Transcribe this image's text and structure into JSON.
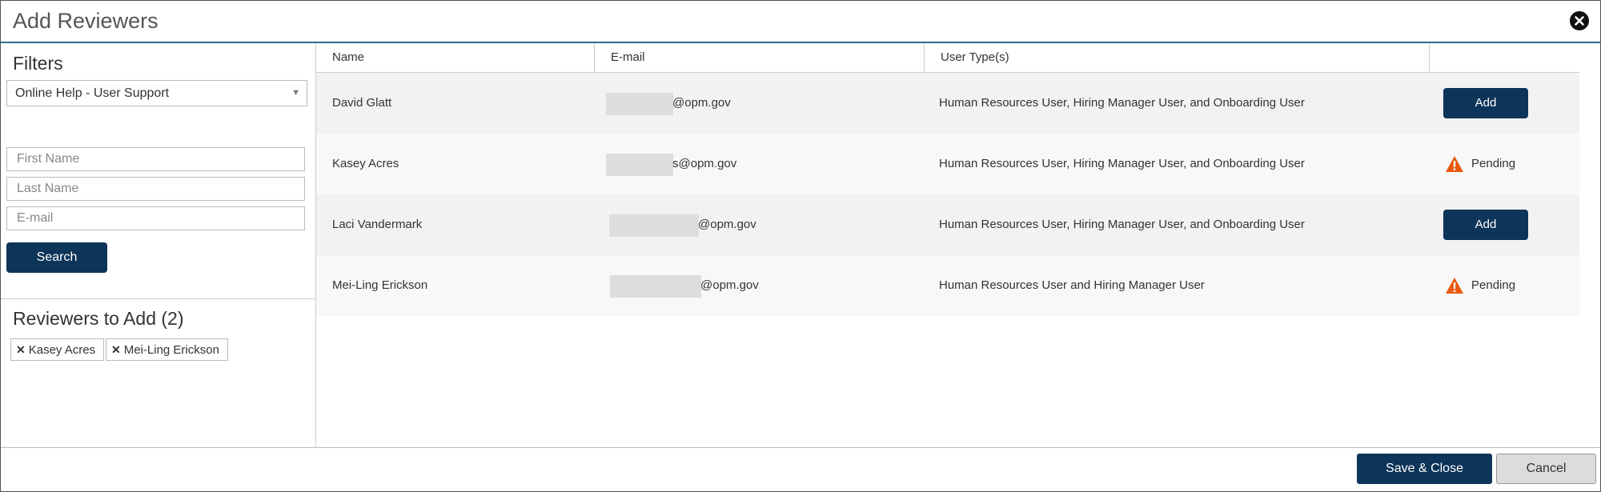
{
  "dialog": {
    "title": "Add Reviewers"
  },
  "filters": {
    "title": "Filters",
    "group_select": {
      "selected": "Online Help - User Support"
    },
    "first_name": {
      "placeholder": "First Name",
      "value": ""
    },
    "last_name": {
      "placeholder": "Last Name",
      "value": ""
    },
    "email": {
      "placeholder": "E-mail",
      "value": ""
    },
    "search_label": "Search"
  },
  "reviewers_to_add": {
    "title": "Reviewers to Add (2)",
    "chips": [
      "Kasey Acres",
      "Mei-Ling Erickson"
    ]
  },
  "table": {
    "columns": [
      "Name",
      "E-mail",
      "User Type(s)",
      ""
    ],
    "rows": [
      {
        "name": "David Glatt",
        "email_visible": "@opm.gov",
        "user_types": "Human Resources User, Hiring Manager User, and Onboarding User",
        "action": "Add"
      },
      {
        "name": "Kasey Acres",
        "email_visible": "s@opm.gov",
        "user_types": "Human Resources User, Hiring Manager User, and Onboarding User",
        "action": "Pending"
      },
      {
        "name": "Laci Vandermark",
        "email_visible": "@opm.gov",
        "user_types": "Human Resources User, Hiring Manager User, and Onboarding User",
        "action": "Add"
      },
      {
        "name": "Mei-Ling Erickson",
        "email_visible": "@opm.gov",
        "user_types": "Human Resources User and Hiring Manager User",
        "action": "Pending"
      }
    ]
  },
  "footer": {
    "save_label": "Save & Close",
    "cancel_label": "Cancel"
  },
  "colors": {
    "primary": "#0d3459",
    "warning": "#e8590c",
    "header_rule": "#2f6e8a"
  }
}
